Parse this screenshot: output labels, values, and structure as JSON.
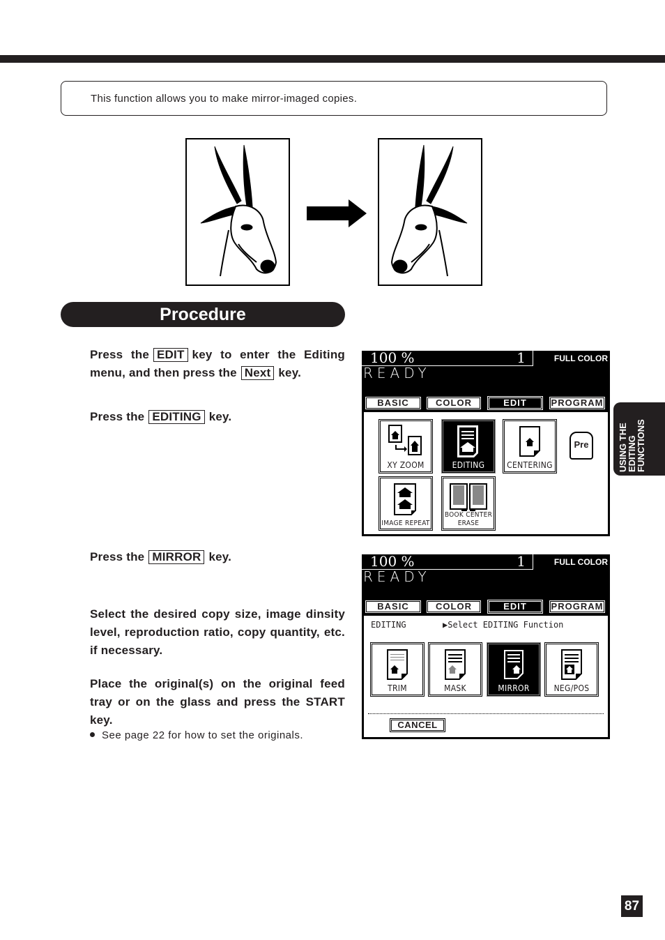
{
  "intro": {
    "text": "This function allows you to make mirror-imaged copies."
  },
  "illustration": {
    "original_label": "original-antelope-image",
    "mirrored_label": "mirrored-antelope-image"
  },
  "procedure": {
    "heading": "Procedure",
    "steps": [
      {
        "pre": "Press the",
        "key": "EDIT",
        "mid": "key to enter the Editing menu, and then press the",
        "key2": "Next",
        "post": "key."
      },
      {
        "pre": "Press the",
        "key": "EDITING",
        "post": "key."
      },
      {
        "pre": "Press the",
        "key": "MIRROR",
        "post": "key."
      },
      {
        "text": "Select the desired copy size, image dinsity level, reproduction ratio, copy quantity, etc. if necessary."
      },
      {
        "text": "Place the original(s) on the original feed tray or on the glass and press the START key."
      }
    ],
    "note": "See page 22 for how to set the originals."
  },
  "panel1": {
    "ratio": "100  %",
    "quantity": "1",
    "mode": "FULL COLOR",
    "status": "READY",
    "tabs": [
      "BASIC",
      "COLOR",
      "EDIT",
      "PROGRAM"
    ],
    "active_tab": "EDIT",
    "buttons": [
      "XY ZOOM",
      "EDITING",
      "CENTERING",
      "IMAGE REPEAT",
      "BOOK CENTER",
      "ERASE"
    ],
    "active_button": "EDITING",
    "pre_label": "Pre"
  },
  "panel2": {
    "ratio": "100  %",
    "quantity": "1",
    "mode": "FULL COLOR",
    "status": "READY",
    "tabs": [
      "BASIC",
      "COLOR",
      "EDIT",
      "PROGRAM"
    ],
    "active_tab": "EDIT",
    "section": "EDITING",
    "prompt": "▶Select EDITING Function",
    "buttons": [
      "TRIM",
      "MASK",
      "MIRROR",
      "NEG/POS"
    ],
    "active_button": "MIRROR",
    "cancel": "CANCEL"
  },
  "side_tab": {
    "line1": "USING THE",
    "line2": "EDITING",
    "line3": "FUNCTIONS"
  },
  "page_number": "87"
}
